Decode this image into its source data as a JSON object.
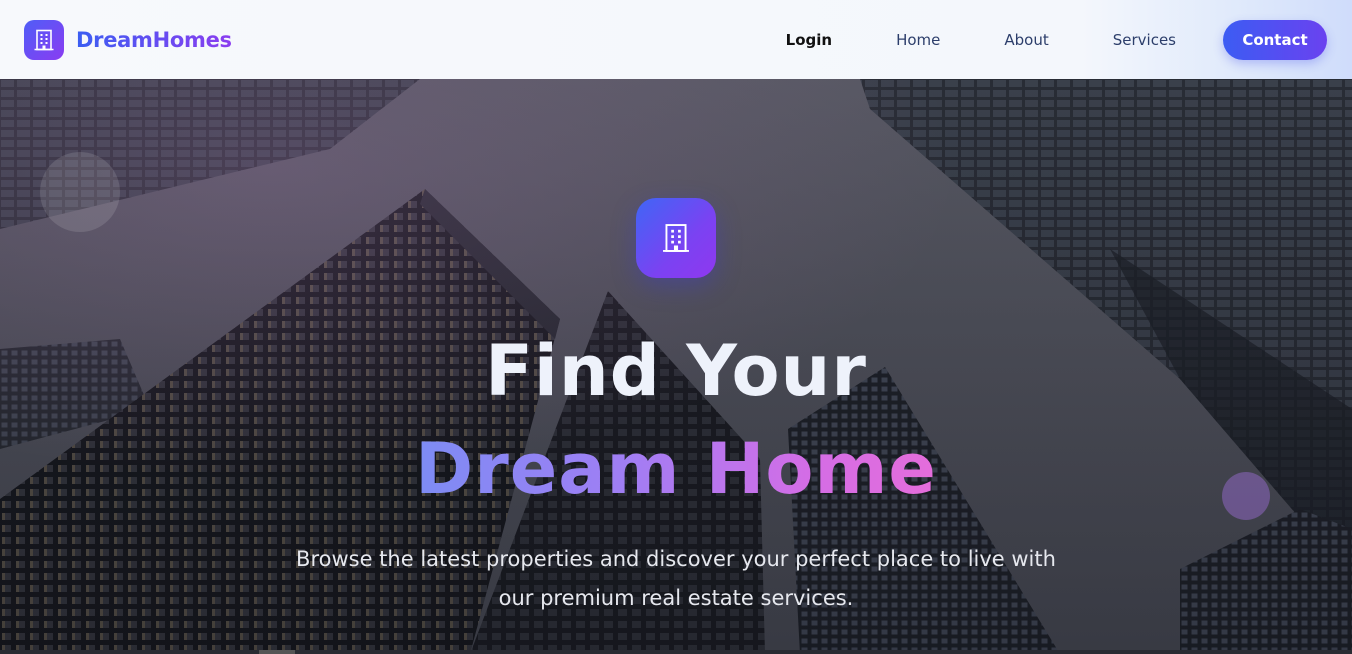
{
  "brand": {
    "name": "DreamHomes",
    "logo_icon": "building-icon"
  },
  "nav": {
    "login": "Login",
    "home": "Home",
    "about": "About",
    "services": "Services",
    "contact": "Contact"
  },
  "hero": {
    "icon": "building-icon",
    "headline_line1": "Find Your",
    "headline_line2": "Dream Home",
    "subtitle": "Browse the latest properties and discover your perfect place to live with our premium real estate services."
  },
  "colors": {
    "accent_start": "#3c5cf3",
    "accent_end": "#8a3cf2",
    "headline_gradient_start": "#7d8cf4",
    "headline_gradient_end": "#e56ddb"
  }
}
